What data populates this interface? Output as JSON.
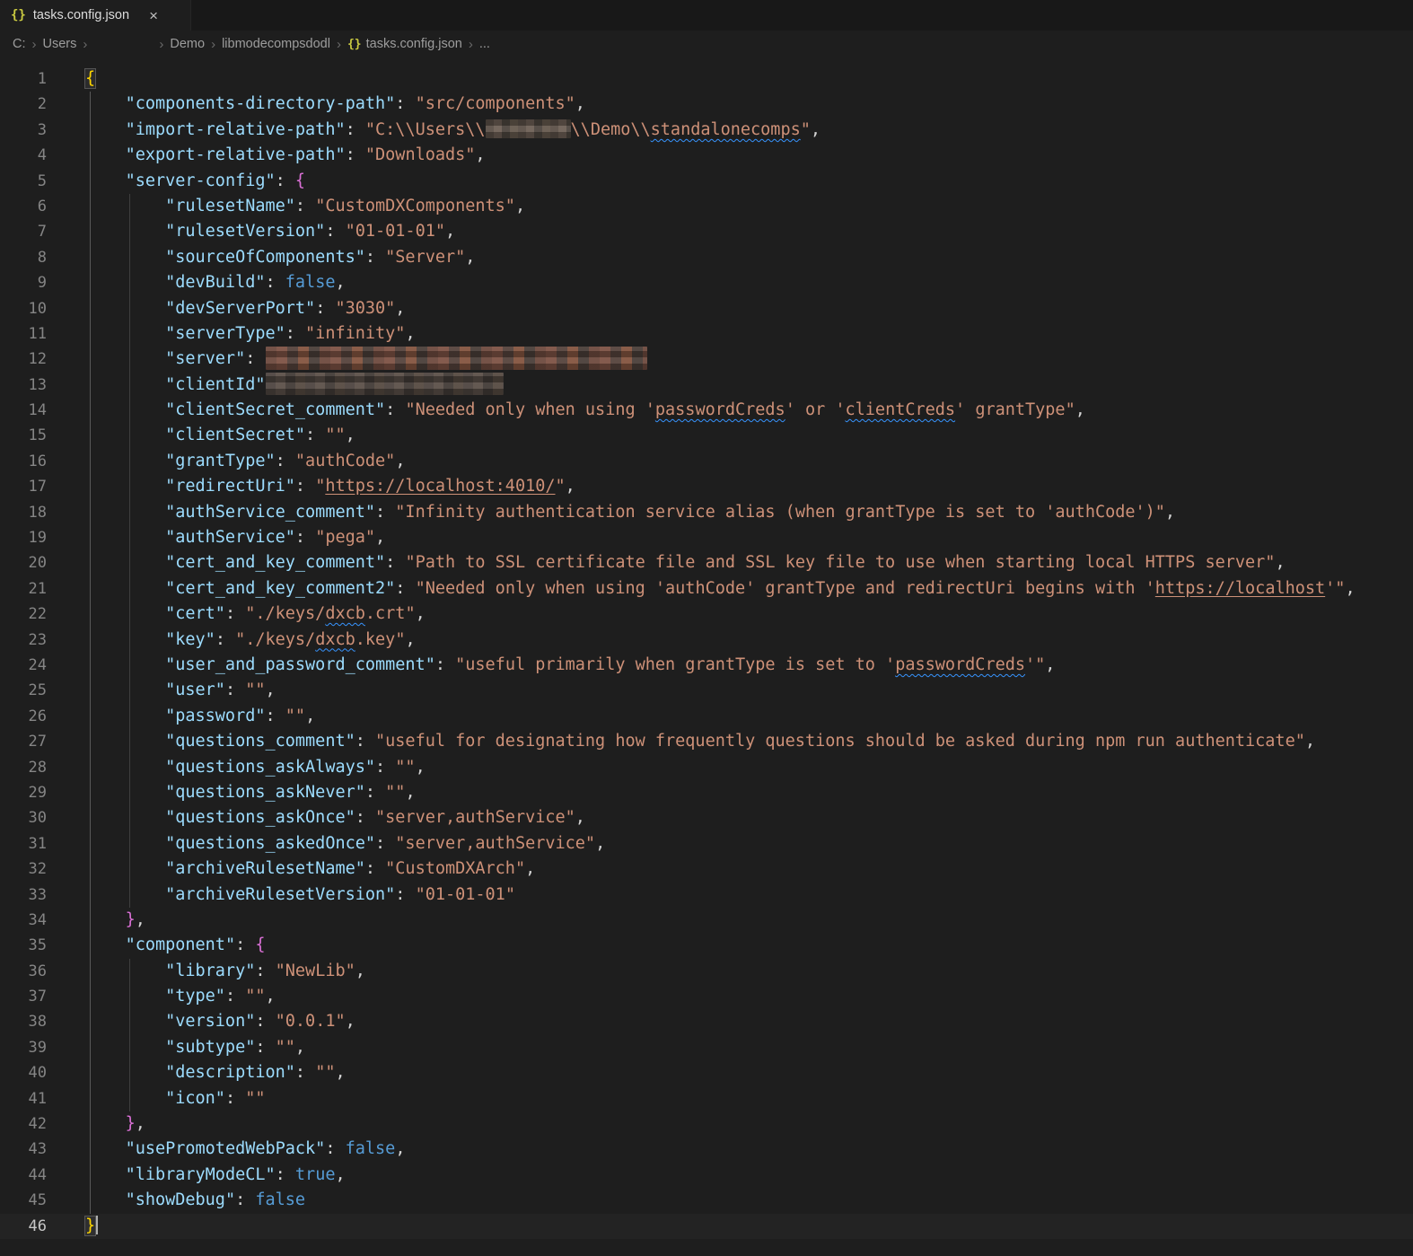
{
  "tab": {
    "title": "tasks.config.json",
    "icon_label": "{}",
    "close_label": "×"
  },
  "breadcrumb": {
    "separator": "›",
    "items": [
      {
        "label": "C:"
      },
      {
        "label": "Users"
      },
      {
        "redacted": true,
        "label": ""
      },
      {
        "label": "Demo"
      },
      {
        "label": "libmodecompsdodl"
      },
      {
        "label": "tasks.config.json",
        "icon": "{}"
      },
      {
        "label": "..."
      }
    ]
  },
  "editor": {
    "lines": [
      {
        "n": 1,
        "tokens": [
          [
            "b1m",
            "{"
          ]
        ]
      },
      {
        "n": 2,
        "tokens": [
          [
            "ws",
            "    "
          ],
          [
            "key",
            "\"components-directory-path\""
          ],
          [
            "punc",
            ": "
          ],
          [
            "str",
            "\"src/components\""
          ],
          [
            "punc",
            ","
          ]
        ]
      },
      {
        "n": 3,
        "tokens": [
          [
            "ws",
            "    "
          ],
          [
            "key",
            "\"import-relative-path\""
          ],
          [
            "punc",
            ": "
          ],
          [
            "str",
            "\"C:\\\\Users\\\\"
          ],
          [
            "red",
            95,
            "p1"
          ],
          [
            "str",
            "\\\\Demo\\\\"
          ],
          [
            "sq",
            "standalonecomps"
          ],
          [
            "str",
            "\""
          ],
          [
            "punc",
            ","
          ]
        ]
      },
      {
        "n": 4,
        "tokens": [
          [
            "ws",
            "    "
          ],
          [
            "key",
            "\"export-relative-path\""
          ],
          [
            "punc",
            ": "
          ],
          [
            "str",
            "\"Downloads\""
          ],
          [
            "punc",
            ","
          ]
        ]
      },
      {
        "n": 5,
        "tokens": [
          [
            "ws",
            "    "
          ],
          [
            "key",
            "\"server-config\""
          ],
          [
            "punc",
            ": "
          ],
          [
            "b2",
            "{"
          ]
        ]
      },
      {
        "n": 6,
        "tokens": [
          [
            "ws",
            "        "
          ],
          [
            "key",
            "\"rulesetName\""
          ],
          [
            "punc",
            ": "
          ],
          [
            "str",
            "\"CustomDXComponents\""
          ],
          [
            "punc",
            ","
          ]
        ]
      },
      {
        "n": 7,
        "tokens": [
          [
            "ws",
            "        "
          ],
          [
            "key",
            "\"rulesetVersion\""
          ],
          [
            "punc",
            ": "
          ],
          [
            "str",
            "\"01-01-01\""
          ],
          [
            "punc",
            ","
          ]
        ]
      },
      {
        "n": 8,
        "tokens": [
          [
            "ws",
            "        "
          ],
          [
            "key",
            "\"sourceOfComponents\""
          ],
          [
            "punc",
            ": "
          ],
          [
            "str",
            "\"Server\""
          ],
          [
            "punc",
            ","
          ]
        ]
      },
      {
        "n": 9,
        "tokens": [
          [
            "ws",
            "        "
          ],
          [
            "key",
            "\"devBuild\""
          ],
          [
            "punc",
            ": "
          ],
          [
            "bool",
            "false"
          ],
          [
            "punc",
            ","
          ]
        ]
      },
      {
        "n": 10,
        "tokens": [
          [
            "ws",
            "        "
          ],
          [
            "key",
            "\"devServerPort\""
          ],
          [
            "punc",
            ": "
          ],
          [
            "str",
            "\"3030\""
          ],
          [
            "punc",
            ","
          ]
        ]
      },
      {
        "n": 11,
        "tokens": [
          [
            "ws",
            "        "
          ],
          [
            "key",
            "\"serverType\""
          ],
          [
            "punc",
            ": "
          ],
          [
            "str",
            "\"infinity\""
          ],
          [
            "punc",
            ","
          ]
        ]
      },
      {
        "n": 12,
        "tokens": [
          [
            "ws",
            "        "
          ],
          [
            "key",
            "\"server\""
          ],
          [
            "punc",
            ": "
          ],
          [
            "red",
            425,
            "p2"
          ]
        ]
      },
      {
        "n": 13,
        "tokens": [
          [
            "ws",
            "        "
          ],
          [
            "key",
            "\"clientId\""
          ],
          [
            "red",
            265,
            "p3"
          ]
        ]
      },
      {
        "n": 14,
        "tokens": [
          [
            "ws",
            "        "
          ],
          [
            "key",
            "\"clientSecret_comment\""
          ],
          [
            "punc",
            ": "
          ],
          [
            "str",
            "\"Needed only when using '"
          ],
          [
            "sq",
            "passwordCreds"
          ],
          [
            "str",
            "' or '"
          ],
          [
            "sq",
            "clientCreds"
          ],
          [
            "str",
            "' grantType\""
          ],
          [
            "punc",
            ","
          ]
        ]
      },
      {
        "n": 15,
        "tokens": [
          [
            "ws",
            "        "
          ],
          [
            "key",
            "\"clientSecret\""
          ],
          [
            "punc",
            ": "
          ],
          [
            "str",
            "\"\""
          ],
          [
            "punc",
            ","
          ]
        ]
      },
      {
        "n": 16,
        "tokens": [
          [
            "ws",
            "        "
          ],
          [
            "key",
            "\"grantType\""
          ],
          [
            "punc",
            ": "
          ],
          [
            "str",
            "\"authCode\""
          ],
          [
            "punc",
            ","
          ]
        ]
      },
      {
        "n": 17,
        "tokens": [
          [
            "ws",
            "        "
          ],
          [
            "key",
            "\"redirectUri\""
          ],
          [
            "punc",
            ": "
          ],
          [
            "str",
            "\""
          ],
          [
            "link",
            "https://localhost:4010/"
          ],
          [
            "str",
            "\""
          ],
          [
            "punc",
            ","
          ]
        ]
      },
      {
        "n": 18,
        "tokens": [
          [
            "ws",
            "        "
          ],
          [
            "key",
            "\"authService_comment\""
          ],
          [
            "punc",
            ": "
          ],
          [
            "str",
            "\"Infinity authentication service alias (when grantType is set to 'authCode')\""
          ],
          [
            "punc",
            ","
          ]
        ]
      },
      {
        "n": 19,
        "tokens": [
          [
            "ws",
            "        "
          ],
          [
            "key",
            "\"authService\""
          ],
          [
            "punc",
            ": "
          ],
          [
            "str",
            "\"pega\""
          ],
          [
            "punc",
            ","
          ]
        ]
      },
      {
        "n": 20,
        "tokens": [
          [
            "ws",
            "        "
          ],
          [
            "key",
            "\"cert_and_key_comment\""
          ],
          [
            "punc",
            ": "
          ],
          [
            "str",
            "\"Path to SSL certificate file and SSL key file to use when starting local HTTPS server\""
          ],
          [
            "punc",
            ","
          ]
        ]
      },
      {
        "n": 21,
        "tokens": [
          [
            "ws",
            "        "
          ],
          [
            "key",
            "\"cert_and_key_comment2\""
          ],
          [
            "punc",
            ": "
          ],
          [
            "str",
            "\"Needed only when using 'authCode' grantType and redirectUri begins with '"
          ],
          [
            "link",
            "https://localhost"
          ],
          [
            "str",
            "'\""
          ],
          [
            "punc",
            ","
          ]
        ]
      },
      {
        "n": 22,
        "tokens": [
          [
            "ws",
            "        "
          ],
          [
            "key",
            "\"cert\""
          ],
          [
            "punc",
            ": "
          ],
          [
            "str",
            "\"./keys/"
          ],
          [
            "sq",
            "dxcb"
          ],
          [
            "str",
            ".crt\""
          ],
          [
            "punc",
            ","
          ]
        ]
      },
      {
        "n": 23,
        "tokens": [
          [
            "ws",
            "        "
          ],
          [
            "key",
            "\"key\""
          ],
          [
            "punc",
            ": "
          ],
          [
            "str",
            "\"./keys/"
          ],
          [
            "sq",
            "dxcb"
          ],
          [
            "str",
            ".key\""
          ],
          [
            "punc",
            ","
          ]
        ]
      },
      {
        "n": 24,
        "tokens": [
          [
            "ws",
            "        "
          ],
          [
            "key",
            "\"user_and_password_comment\""
          ],
          [
            "punc",
            ": "
          ],
          [
            "str",
            "\"useful primarily when grantType is set to '"
          ],
          [
            "sq",
            "passwordCreds"
          ],
          [
            "str",
            "'\""
          ],
          [
            "punc",
            ","
          ]
        ]
      },
      {
        "n": 25,
        "tokens": [
          [
            "ws",
            "        "
          ],
          [
            "key",
            "\"user\""
          ],
          [
            "punc",
            ": "
          ],
          [
            "str",
            "\"\""
          ],
          [
            "punc",
            ","
          ]
        ]
      },
      {
        "n": 26,
        "tokens": [
          [
            "ws",
            "        "
          ],
          [
            "key",
            "\"password\""
          ],
          [
            "punc",
            ": "
          ],
          [
            "str",
            "\"\""
          ],
          [
            "punc",
            ","
          ]
        ]
      },
      {
        "n": 27,
        "tokens": [
          [
            "ws",
            "        "
          ],
          [
            "key",
            "\"questions_comment\""
          ],
          [
            "punc",
            ": "
          ],
          [
            "str",
            "\"useful for designating how frequently questions should be asked during npm run authenticate\""
          ],
          [
            "punc",
            ","
          ]
        ]
      },
      {
        "n": 28,
        "tokens": [
          [
            "ws",
            "        "
          ],
          [
            "key",
            "\"questions_askAlways\""
          ],
          [
            "punc",
            ": "
          ],
          [
            "str",
            "\"\""
          ],
          [
            "punc",
            ","
          ]
        ]
      },
      {
        "n": 29,
        "tokens": [
          [
            "ws",
            "        "
          ],
          [
            "key",
            "\"questions_askNever\""
          ],
          [
            "punc",
            ": "
          ],
          [
            "str",
            "\"\""
          ],
          [
            "punc",
            ","
          ]
        ]
      },
      {
        "n": 30,
        "tokens": [
          [
            "ws",
            "        "
          ],
          [
            "key",
            "\"questions_askOnce\""
          ],
          [
            "punc",
            ": "
          ],
          [
            "str",
            "\"server,authService\""
          ],
          [
            "punc",
            ","
          ]
        ]
      },
      {
        "n": 31,
        "tokens": [
          [
            "ws",
            "        "
          ],
          [
            "key",
            "\"questions_askedOnce\""
          ],
          [
            "punc",
            ": "
          ],
          [
            "str",
            "\"server,authService\""
          ],
          [
            "punc",
            ","
          ]
        ]
      },
      {
        "n": 32,
        "tokens": [
          [
            "ws",
            "        "
          ],
          [
            "key",
            "\"archiveRulesetName\""
          ],
          [
            "punc",
            ": "
          ],
          [
            "str",
            "\"CustomDXArch\""
          ],
          [
            "punc",
            ","
          ]
        ]
      },
      {
        "n": 33,
        "tokens": [
          [
            "ws",
            "        "
          ],
          [
            "key",
            "\"archiveRulesetVersion\""
          ],
          [
            "punc",
            ": "
          ],
          [
            "str",
            "\"01-01-01\""
          ]
        ]
      },
      {
        "n": 34,
        "tokens": [
          [
            "ws",
            "    "
          ],
          [
            "b2",
            "}"
          ],
          [
            "punc",
            ","
          ]
        ]
      },
      {
        "n": 35,
        "tokens": [
          [
            "ws",
            "    "
          ],
          [
            "key",
            "\"component\""
          ],
          [
            "punc",
            ": "
          ],
          [
            "b2",
            "{"
          ]
        ]
      },
      {
        "n": 36,
        "tokens": [
          [
            "ws",
            "        "
          ],
          [
            "key",
            "\"library\""
          ],
          [
            "punc",
            ": "
          ],
          [
            "str",
            "\"NewLib\""
          ],
          [
            "punc",
            ","
          ]
        ]
      },
      {
        "n": 37,
        "tokens": [
          [
            "ws",
            "        "
          ],
          [
            "key",
            "\"type\""
          ],
          [
            "punc",
            ": "
          ],
          [
            "str",
            "\"\""
          ],
          [
            "punc",
            ","
          ]
        ]
      },
      {
        "n": 38,
        "tokens": [
          [
            "ws",
            "        "
          ],
          [
            "key",
            "\"version\""
          ],
          [
            "punc",
            ": "
          ],
          [
            "str",
            "\"0.0.1\""
          ],
          [
            "punc",
            ","
          ]
        ]
      },
      {
        "n": 39,
        "tokens": [
          [
            "ws",
            "        "
          ],
          [
            "key",
            "\"subtype\""
          ],
          [
            "punc",
            ": "
          ],
          [
            "str",
            "\"\""
          ],
          [
            "punc",
            ","
          ]
        ]
      },
      {
        "n": 40,
        "tokens": [
          [
            "ws",
            "        "
          ],
          [
            "key",
            "\"description\""
          ],
          [
            "punc",
            ": "
          ],
          [
            "str",
            "\"\""
          ],
          [
            "punc",
            ","
          ]
        ]
      },
      {
        "n": 41,
        "tokens": [
          [
            "ws",
            "        "
          ],
          [
            "key",
            "\"icon\""
          ],
          [
            "punc",
            ": "
          ],
          [
            "str",
            "\"\""
          ]
        ]
      },
      {
        "n": 42,
        "tokens": [
          [
            "ws",
            "    "
          ],
          [
            "b2",
            "}"
          ],
          [
            "punc",
            ","
          ]
        ]
      },
      {
        "n": 43,
        "tokens": [
          [
            "ws",
            "    "
          ],
          [
            "key",
            "\"usePromotedWebPack\""
          ],
          [
            "punc",
            ": "
          ],
          [
            "bool",
            "false"
          ],
          [
            "punc",
            ","
          ]
        ]
      },
      {
        "n": 44,
        "tokens": [
          [
            "ws",
            "    "
          ],
          [
            "key",
            "\"libraryModeCL\""
          ],
          [
            "punc",
            ": "
          ],
          [
            "bool",
            "true"
          ],
          [
            "punc",
            ","
          ]
        ]
      },
      {
        "n": 45,
        "tokens": [
          [
            "ws",
            "    "
          ],
          [
            "key",
            "\"showDebug\""
          ],
          [
            "punc",
            ": "
          ],
          [
            "bool",
            "false"
          ]
        ]
      },
      {
        "n": 46,
        "active": true,
        "cursor": true,
        "tokens": [
          [
            "b1m",
            "}"
          ]
        ]
      }
    ]
  }
}
